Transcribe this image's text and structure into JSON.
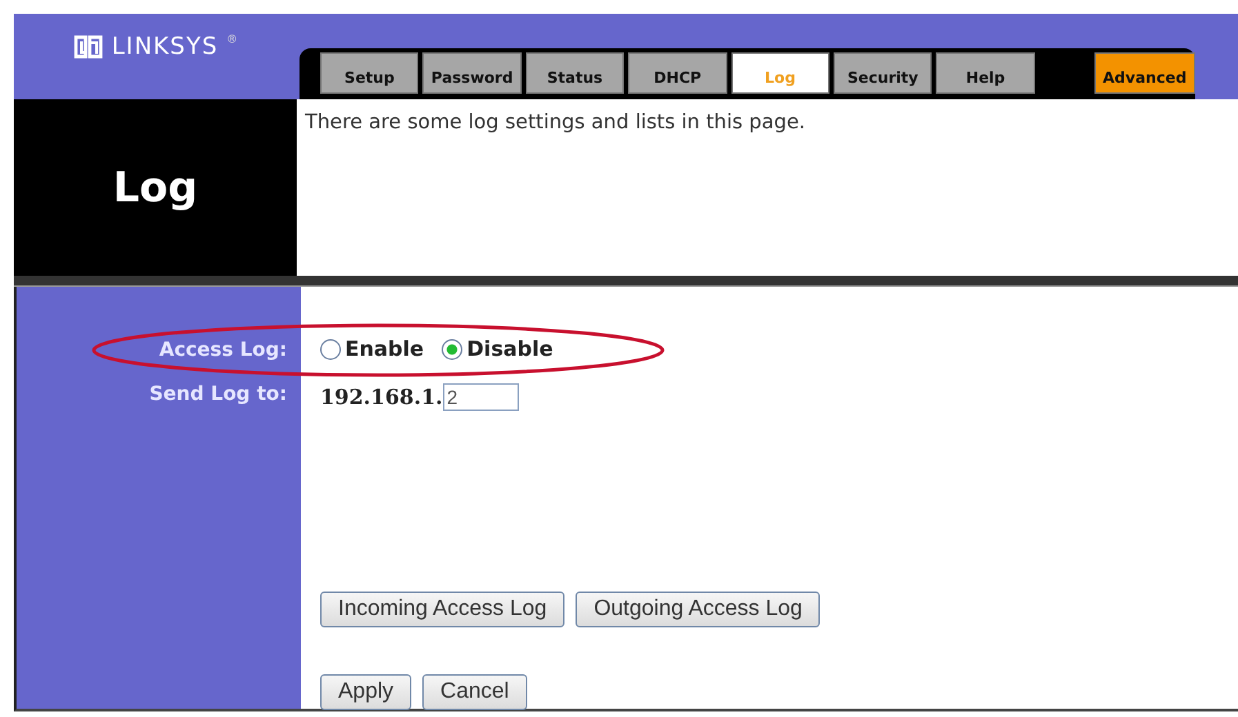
{
  "logo": {
    "wordmark": "LINKSYS",
    "registered": "®"
  },
  "tabs": [
    {
      "label": "Setup",
      "kind": "page",
      "selected": false
    },
    {
      "label": "Password",
      "kind": "page",
      "selected": false
    },
    {
      "label": "Status",
      "kind": "page",
      "selected": false
    },
    {
      "label": "DHCP",
      "kind": "page",
      "selected": false
    },
    {
      "label": "Log",
      "kind": "page",
      "selected": true
    },
    {
      "label": "Security",
      "kind": "page",
      "selected": false
    },
    {
      "label": "Help",
      "kind": "page",
      "selected": false
    },
    {
      "label": "Advanced",
      "kind": "advanced",
      "selected": false
    }
  ],
  "page_title": "Log",
  "intro": "There are some log settings and lists in this page.",
  "access_log": {
    "label": "Access Log:",
    "options": [
      {
        "label": "Enable",
        "selected": false
      },
      {
        "label": "Disable",
        "selected": true
      }
    ],
    "highlighted": true
  },
  "send_log_to": {
    "label": "Send Log to:",
    "prefix": "192.168.1.",
    "value": "2"
  },
  "log_buttons": [
    "Incoming Access Log",
    "Outgoing Access Log"
  ],
  "action_buttons": [
    "Apply",
    "Cancel"
  ]
}
